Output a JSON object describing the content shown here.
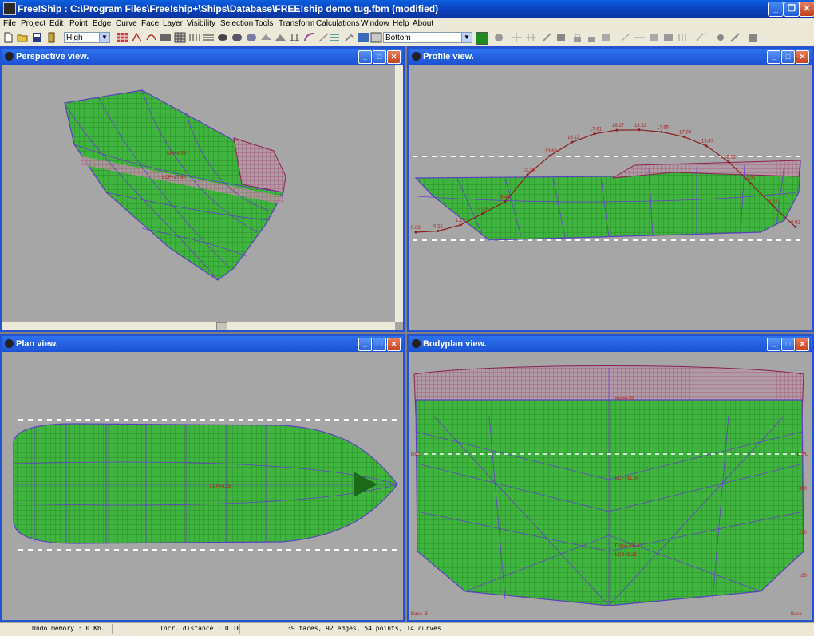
{
  "window": {
    "title": "Free!Ship  : C:\\Program Files\\Free!ship+\\Ships\\Database\\FREE!ship demo tug.fbm (modified)"
  },
  "menu": [
    "File",
    "Project",
    "Edit",
    "Point",
    "Edge",
    "Curve",
    "Face",
    "Layer",
    "Visibility",
    "Selection",
    "Tools",
    "Transform",
    "Calculations",
    "Window",
    "Help",
    "About"
  ],
  "toolbar": {
    "precision": "High",
    "view_select": "Bottom",
    "accent": "#1e8c1e"
  },
  "views": {
    "perspective": {
      "title": "Perspective view."
    },
    "profile": {
      "title": "Profile view."
    },
    "plan": {
      "title": "Plan view."
    },
    "bodyplan": {
      "title": "Bodyplan view."
    }
  },
  "profile_curve_values": [
    "0.00",
    "0.22",
    "1.29",
    "3.35",
    "5.46",
    "10.29",
    "13.68",
    "16.12",
    "17.61",
    "18.27",
    "18.32",
    "17.95",
    "17.09",
    "15.47",
    "12.61",
    "8.71",
    "4.61",
    "0.92"
  ],
  "labels": {
    "km": "KM=4.59",
    "lcf_perspective": "LCF=17.89",
    "lcf_plan": "LCF=5.25",
    "lcf_body": "LCF=11.89",
    "disp": "Disp=765.47",
    "lcb": "LCB=5.25",
    "base_left": "Base -3",
    "base_right": "Base",
    "dwl_left": "DWL",
    "dwl_right": "DWL",
    "scale": [
      "300",
      "200",
      "100"
    ]
  },
  "status": {
    "undo": "Undo memory : 0 Kb.",
    "incr": "Incr. distance : 0.10",
    "counts": "39 faces, 92 edges, 54 points, 14 curves"
  }
}
